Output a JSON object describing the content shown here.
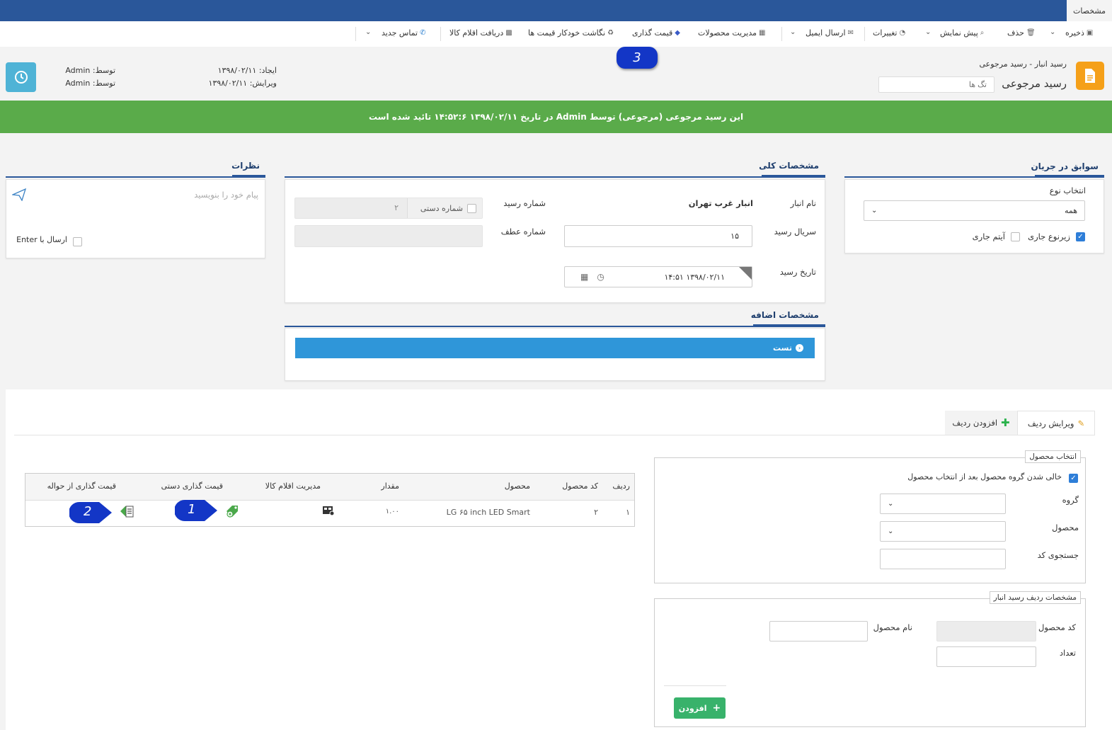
{
  "topbar": {
    "tab": "مشخصات"
  },
  "toolbar": {
    "save": "ذخیره",
    "delete": "حذف",
    "preview": "پیش نمایش",
    "changes": "تغییرات",
    "send_email": "ارسال ایمیل",
    "product_management": "مدیریت محصولات",
    "pricing": "قیمت گذاری",
    "auto_pricing": "نگاشت خودکار قیمت ها",
    "receive_items": "دریافت اقلام کالا",
    "new_contact": "تماس جدید"
  },
  "header": {
    "breadcrumb_1": "رسید انبار",
    "breadcrumb_sep": "-",
    "breadcrumb_2": "رسید مرجوعی",
    "title": "رسید مرجوعی",
    "tags_placeholder": "تگ ها",
    "created_label": "ایجاد:",
    "created_date": "۱۳۹۸/۰۲/۱۱",
    "by_label_1": "توسط:",
    "created_by": "Admin",
    "edited_label": "ویرایش:",
    "edited_date": "۱۳۹۸/۰۲/۱۱",
    "by_label_2": "توسط:",
    "edited_by": "Admin"
  },
  "badges": {
    "b1": "1",
    "b2": "2",
    "b3": "3"
  },
  "status": {
    "message": "این رسید مرجوعی (مرجوعی) توسط Admin در تاریخ ۱۳۹۸/۰۲/۱۱ ۱۴:۵۲:۶ تائید شده است"
  },
  "workflow": {
    "title": "سوابق در جریان",
    "select_type_label": "انتخاب نوع",
    "select_type_value": "همه",
    "current_subtype": "زیرنوع جاری",
    "current_item": "آیتم جاری"
  },
  "general": {
    "title": "مشخصات کلی",
    "warehouse_label": "نام انبار",
    "warehouse_value": "انبار غرب تهران",
    "receipt_no_label": "شماره رسید",
    "manual_number": "شماره دستی",
    "receipt_no_value": "۲",
    "serial_label": "سریال رسید",
    "serial_value": "۱۵",
    "ref_no_label": "شماره عطف",
    "date_label": "تاریخ رسید",
    "date_value": "۱۳۹۸/۰۲/۱۱ ۱۴:۵۱"
  },
  "extra": {
    "title": "مشخصات اضافه",
    "bar_label": "تست"
  },
  "comments": {
    "title": "نظرات",
    "placeholder": "پیام خود را بنویسید",
    "send_with_enter": "ارسال با Enter"
  },
  "rows": {
    "edit_tab": "ویرایش ردیف",
    "add_tab": "افزودن ردیف"
  },
  "select_product": {
    "legend": "انتخاب محصول",
    "clear_group": "خالی شدن گروه محصول بعد از انتخاب محصول",
    "group_label": "گروه",
    "product_label": "محصول",
    "code_search_label": "جستجوی کد"
  },
  "row_details": {
    "legend": "مشخصات ردیف رسید انبار",
    "code_label": "کد محصول",
    "name_label": "نام محصول",
    "qty_label": "تعداد",
    "add_button": "افزودن"
  },
  "table": {
    "headers": {
      "row": "ردیف",
      "code": "کد محصول",
      "product": "محصول",
      "qty": "مقدار",
      "items_mgmt": "مدیریت اقلام کالا",
      "manual_pricing": "قیمت گذاری دستی",
      "transfer_pricing": "قیمت گذاری از حواله"
    },
    "rows": [
      {
        "row": "۱",
        "code": "۲",
        "product": "LG ۶۵ inch LED Smart",
        "qty": "۱.۰۰"
      }
    ]
  }
}
